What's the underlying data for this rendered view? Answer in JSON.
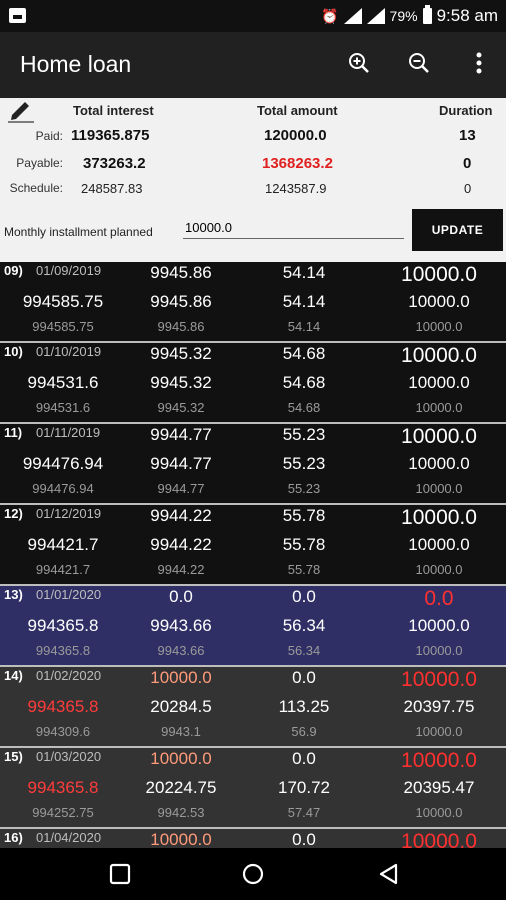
{
  "status_bar": {
    "battery": "79%",
    "time": "9:58 am"
  },
  "app_bar": {
    "title": "Home loan"
  },
  "summary": {
    "headers": {
      "interest": "Total interest",
      "amount": "Total amount",
      "duration": "Duration"
    },
    "paid": {
      "label": "Paid:",
      "interest": "119365.875",
      "amount": "120000.0",
      "duration": "13"
    },
    "payable": {
      "label": "Payable:",
      "interest": "373263.2",
      "amount": "1368263.2",
      "duration": "0"
    },
    "schedule": {
      "label": "Schedule:",
      "interest": "248587.83",
      "amount": "1243587.9",
      "duration": "0"
    },
    "monthly_label": "Monthly installment planned",
    "monthly_value": "10000.0",
    "update_label": "UPDATE"
  },
  "rows": [
    {
      "num": "09)",
      "date": "01/09/2019",
      "a1": "9945.86",
      "b1": "54.14",
      "c1": "10000.0",
      "x2": "994585.75",
      "a2": "9945.86",
      "b2": "54.14",
      "c2": "10000.0",
      "x3": "994585.75",
      "a3": "9945.86",
      "b3": "54.14",
      "c3": "10000.0"
    },
    {
      "num": "10)",
      "date": "01/10/2019",
      "a1": "9945.32",
      "b1": "54.68",
      "c1": "10000.0",
      "x2": "994531.6",
      "a2": "9945.32",
      "b2": "54.68",
      "c2": "10000.0",
      "x3": "994531.6",
      "a3": "9945.32",
      "b3": "54.68",
      "c3": "10000.0"
    },
    {
      "num": "11)",
      "date": "01/11/2019",
      "a1": "9944.77",
      "b1": "55.23",
      "c1": "10000.0",
      "x2": "994476.94",
      "a2": "9944.77",
      "b2": "55.23",
      "c2": "10000.0",
      "x3": "994476.94",
      "a3": "9944.77",
      "b3": "55.23",
      "c3": "10000.0"
    },
    {
      "num": "12)",
      "date": "01/12/2019",
      "a1": "9944.22",
      "b1": "55.78",
      "c1": "10000.0",
      "x2": "994421.7",
      "a2": "9944.22",
      "b2": "55.78",
      "c2": "10000.0",
      "x3": "994421.7",
      "a3": "9944.22",
      "b3": "55.78",
      "c3": "10000.0"
    },
    {
      "num": "13)",
      "date": "01/01/2020",
      "a1": "0.0",
      "b1": "0.0",
      "c1": "0.0",
      "x2": "994365.8",
      "a2": "9943.66",
      "b2": "56.34",
      "c2": "10000.0",
      "x3": "994365.8",
      "a3": "9943.66",
      "b3": "56.34",
      "c3": "10000.0"
    },
    {
      "num": "14)",
      "date": "01/02/2020",
      "a1": "10000.0",
      "b1": "0.0",
      "c1": "10000.0",
      "x2": "994365.8",
      "a2": "20284.5",
      "b2": "113.25",
      "c2": "20397.75",
      "x3": "994309.6",
      "a3": "9943.1",
      "b3": "56.9",
      "c3": "10000.0"
    },
    {
      "num": "15)",
      "date": "01/03/2020",
      "a1": "10000.0",
      "b1": "0.0",
      "c1": "10000.0",
      "x2": "994365.8",
      "a2": "20224.75",
      "b2": "170.72",
      "c2": "20395.47",
      "x3": "994252.75",
      "a3": "9942.53",
      "b3": "57.47",
      "c3": "10000.0"
    },
    {
      "num": "16)",
      "date": "01/04/2020",
      "a1": "10000.0",
      "b1": "0.0",
      "c1": "10000.0",
      "x2": "",
      "a2": "",
      "b2": "",
      "c2": "",
      "x3": "",
      "a3": "",
      "b3": "",
      "c3": ""
    }
  ]
}
